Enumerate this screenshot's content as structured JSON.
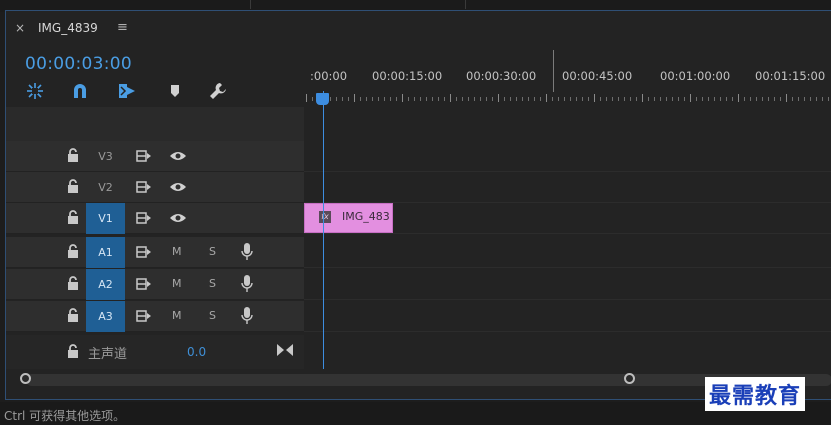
{
  "panel": {
    "close_glyph": "×",
    "title": "IMG_4839",
    "menu_glyph": "≡",
    "timecode": "00:00:03:00"
  },
  "toolbar": {
    "icons": [
      "nest-sequences-icon",
      "snap-magnet-icon",
      "linked-selection-icon",
      "add-marker-icon",
      "wrench-settings-icon"
    ]
  },
  "ruler": {
    "labels": [
      ":00:00",
      "00:00:15:00",
      "00:00:30:00",
      "00:00:45:00",
      "00:01:00:00",
      "00:01:15:00"
    ],
    "start_seconds": 0,
    "label_interval_seconds": 15,
    "playhead_seconds": 3
  },
  "video_tracks": [
    {
      "name": "V3",
      "active": false
    },
    {
      "name": "V2",
      "active": false
    },
    {
      "name": "V1",
      "active": true
    }
  ],
  "audio_tracks": [
    {
      "name": "A1",
      "mute": "M",
      "solo": "S"
    },
    {
      "name": "A2",
      "mute": "M",
      "solo": "S"
    },
    {
      "name": "A3",
      "mute": "M",
      "solo": "S"
    }
  ],
  "master": {
    "label": "主声道",
    "value": "0.0"
  },
  "clip": {
    "fx": "fx",
    "label": "IMG_483",
    "color": "#e38fe0"
  },
  "status": {
    "text": "Ctrl 可获得其他选项。"
  },
  "watermark": "最需教育",
  "colors": {
    "accent": "#3d8de0",
    "track_active": "#1f5f95",
    "work_area": "#e3d51a"
  }
}
